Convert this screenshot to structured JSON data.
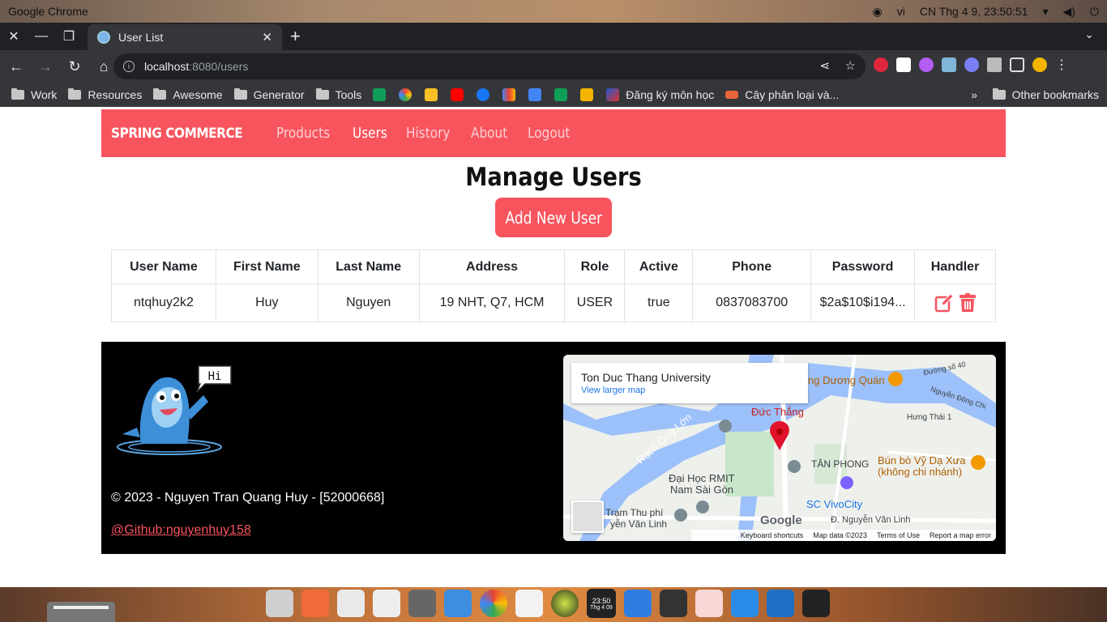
{
  "os": {
    "app_name": "Google Chrome",
    "lang": "vi",
    "datetime": "CN Thg 4  9, 23:50:51"
  },
  "browser": {
    "tab_title": "User List",
    "url_host": "localhost",
    "url_path": ":8080/users",
    "bookmarks": [
      "Work",
      "Resources",
      "Awesome",
      "Generator",
      "Tools"
    ],
    "bookmark_dkmh": "Đăng ký môn học",
    "bookmark_cay": "Cây phân loại và...",
    "other_bookmarks": "Other bookmarks"
  },
  "navbar": {
    "brand": "SPRING COMMERCE",
    "links": [
      "Products",
      "Users",
      "History",
      "About",
      "Logout"
    ],
    "active": "Users"
  },
  "main": {
    "title": "Manage Users",
    "add_button": "Add New User"
  },
  "table": {
    "headers": [
      "User Name",
      "First Name",
      "Last Name",
      "Address",
      "Role",
      "Active",
      "Phone",
      "Password",
      "Handler"
    ],
    "rows": [
      [
        "ntqhuy2k2",
        "Huy",
        "Nguyen",
        "19 NHT, Q7, HCM",
        "USER",
        "true",
        "0837083700",
        "$2a$10$i194..."
      ]
    ]
  },
  "footer": {
    "mascot_bubble": "Hi",
    "copyright": "© 2023 - Nguyen Tran Quang Huy - [52000668]",
    "github": "@Github:nguyenhuy158"
  },
  "map": {
    "place": "Ton Duc Thang University",
    "larger_map": "View larger map",
    "labels": [
      "Đức Thắng",
      "Rạch Ông Lớn",
      "Đại Học RMIT",
      "Nam Sài Gòn",
      "TÂN PHONG",
      "SC VivoCity",
      "Bún bò Vỹ Dạ Xưa",
      "(không chi nhánh)",
      "ng Dương Quán",
      "Đ. Nguyễn Văn Linh",
      "Trạm Thu phí",
      "yễn Văn Linh",
      "Hưng Thái 1",
      "Đường số 40",
      "Nguyễn Đông Chi"
    ],
    "footer": [
      "Keyboard shortcuts",
      "Map data ©2023",
      "Terms of Use",
      "Report a map error"
    ],
    "google": "Google"
  },
  "dock": {
    "clock_time": "23:50",
    "clock_date": "Thg 4 09"
  }
}
